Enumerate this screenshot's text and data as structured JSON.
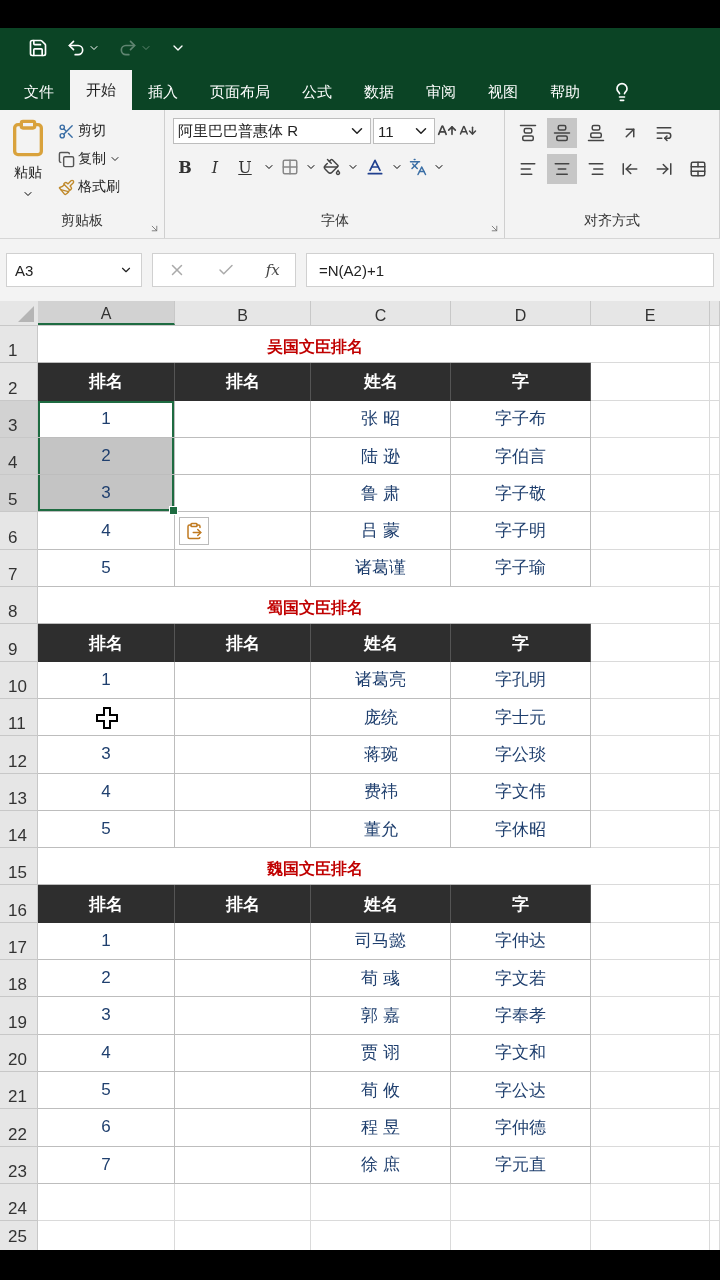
{
  "quick_access": {
    "redo_disabled": true
  },
  "tabs": [
    {
      "label": "文件",
      "selected": false
    },
    {
      "label": "开始",
      "selected": true
    },
    {
      "label": "插入",
      "selected": false
    },
    {
      "label": "页面布局",
      "selected": false
    },
    {
      "label": "公式",
      "selected": false
    },
    {
      "label": "数据",
      "selected": false
    },
    {
      "label": "审阅",
      "selected": false
    },
    {
      "label": "视图",
      "selected": false
    },
    {
      "label": "帮助",
      "selected": false
    }
  ],
  "ribbon": {
    "clipboard": {
      "paste": "粘贴",
      "cut": "剪切",
      "copy": "复制",
      "format_painter": "格式刷",
      "label": "剪贴板"
    },
    "font": {
      "font_name": "阿里巴巴普惠体 R",
      "font_size": "11",
      "bold": "B",
      "italic": "I",
      "underline": "U",
      "label": "字体"
    },
    "alignment": {
      "label": "对齐方式",
      "buttons": [
        {
          "kind": "top",
          "selected": false
        },
        {
          "kind": "middle",
          "selected": true
        },
        {
          "kind": "bottom",
          "selected": false
        },
        {
          "kind": "orientation",
          "selected": false
        },
        {
          "kind": "wrap",
          "selected": false
        },
        {
          "kind": "left",
          "selected": false
        },
        {
          "kind": "center",
          "selected": true
        },
        {
          "kind": "right",
          "selected": false
        },
        {
          "kind": "outdent",
          "selected": false
        },
        {
          "kind": "indent",
          "selected": false
        },
        {
          "kind": "merge",
          "selected": false
        }
      ]
    }
  },
  "formula_bar": {
    "name_box": "A3",
    "fx": "fx",
    "formula": "=N(A2)+1"
  },
  "columns": [
    {
      "label": "A",
      "selected": true
    },
    {
      "label": "B",
      "selected": false
    },
    {
      "label": "C",
      "selected": false
    },
    {
      "label": "D",
      "selected": false
    },
    {
      "label": "E",
      "selected": false
    }
  ],
  "rows": [
    {
      "number": "1",
      "kind": "title",
      "text": "吴国文臣排名"
    },
    {
      "number": "2",
      "kind": "header",
      "cells": [
        "排名",
        "排名",
        "姓名",
        "字"
      ]
    },
    {
      "number": "3",
      "kind": "data",
      "cells": [
        {
          "kind": "text",
          "text": "1",
          "selected": true
        },
        {
          "kind": "text",
          "selected": false
        },
        {
          "kind": "text",
          "text": "张 昭",
          "selected": false
        },
        {
          "kind": "text",
          "text": "字子布",
          "selected": false
        }
      ]
    },
    {
      "number": "4",
      "kind": "data",
      "cells": [
        {
          "kind": "text",
          "text": "2",
          "selected": true
        },
        {
          "kind": "text",
          "selected": false
        },
        {
          "kind": "text",
          "text": "陆 逊",
          "selected": false
        },
        {
          "kind": "text",
          "text": "字伯言",
          "selected": false
        }
      ]
    },
    {
      "number": "5",
      "kind": "data",
      "cells": [
        {
          "kind": "text",
          "text": "3",
          "selected": true
        },
        {
          "kind": "text",
          "selected": false
        },
        {
          "kind": "text",
          "text": "鲁 肃",
          "selected": false
        },
        {
          "kind": "text",
          "text": "字子敬",
          "selected": false
        }
      ]
    },
    {
      "number": "6",
      "kind": "data",
      "cells": [
        {
          "kind": "text",
          "text": "4",
          "selected": false
        },
        {
          "kind": "paste_options",
          "selected": false
        },
        {
          "kind": "text",
          "text": "吕 蒙",
          "selected": false
        },
        {
          "kind": "text",
          "text": "字子明",
          "selected": false
        }
      ]
    },
    {
      "number": "7",
      "kind": "data",
      "cells": [
        {
          "kind": "text",
          "text": "5",
          "selected": false
        },
        {
          "kind": "text",
          "selected": false
        },
        {
          "kind": "text",
          "text": "诸葛谨",
          "selected": false
        },
        {
          "kind": "text",
          "text": "字子瑜",
          "selected": false
        }
      ]
    },
    {
      "number": "8",
      "kind": "title",
      "text": "蜀国文臣排名"
    },
    {
      "number": "9",
      "kind": "header",
      "cells": [
        "排名",
        "排名",
        "姓名",
        "字"
      ]
    },
    {
      "number": "10",
      "kind": "data",
      "cells": [
        {
          "kind": "text",
          "text": "1",
          "selected": false
        },
        {
          "kind": "text",
          "selected": false
        },
        {
          "kind": "text",
          "text": "诸葛亮",
          "selected": false
        },
        {
          "kind": "text",
          "text": "字孔明",
          "selected": false
        }
      ]
    },
    {
      "number": "11",
      "kind": "data",
      "cells": [
        {
          "kind": "cursor",
          "selected": false
        },
        {
          "kind": "text",
          "selected": false
        },
        {
          "kind": "text",
          "text": "庞统",
          "selected": false
        },
        {
          "kind": "text",
          "text": "字士元",
          "selected": false
        }
      ]
    },
    {
      "number": "12",
      "kind": "data",
      "cells": [
        {
          "kind": "text",
          "text": "3",
          "selected": false
        },
        {
          "kind": "text",
          "selected": false
        },
        {
          "kind": "text",
          "text": "蒋琬",
          "selected": false
        },
        {
          "kind": "text",
          "text": "字公琰",
          "selected": false
        }
      ]
    },
    {
      "number": "13",
      "kind": "data",
      "cells": [
        {
          "kind": "text",
          "text": "4",
          "selected": false
        },
        {
          "kind": "text",
          "selected": false
        },
        {
          "kind": "text",
          "text": "费祎",
          "selected": false
        },
        {
          "kind": "text",
          "text": "字文伟",
          "selected": false
        }
      ]
    },
    {
      "number": "14",
      "kind": "data",
      "cells": [
        {
          "kind": "text",
          "text": "5",
          "selected": false
        },
        {
          "kind": "text",
          "selected": false
        },
        {
          "kind": "text",
          "text": "董允",
          "selected": false
        },
        {
          "kind": "text",
          "text": "字休昭",
          "selected": false
        }
      ]
    },
    {
      "number": "15",
      "kind": "title",
      "text": "魏国文臣排名"
    },
    {
      "number": "16",
      "kind": "header",
      "cells": [
        "排名",
        "排名",
        "姓名",
        "字"
      ]
    },
    {
      "number": "17",
      "kind": "data",
      "cells": [
        {
          "kind": "text",
          "text": "1",
          "selected": false
        },
        {
          "kind": "text",
          "selected": false
        },
        {
          "kind": "text",
          "text": "司马懿",
          "selected": false
        },
        {
          "kind": "text",
          "text": "字仲达",
          "selected": false
        }
      ]
    },
    {
      "number": "18",
      "kind": "data",
      "cells": [
        {
          "kind": "text",
          "text": "2",
          "selected": false
        },
        {
          "kind": "text",
          "selected": false
        },
        {
          "kind": "text",
          "text": "荀 彧",
          "selected": false
        },
        {
          "kind": "text",
          "text": "字文若",
          "selected": false
        }
      ]
    },
    {
      "number": "19",
      "kind": "data",
      "cells": [
        {
          "kind": "text",
          "text": "3",
          "selected": false
        },
        {
          "kind": "text",
          "selected": false
        },
        {
          "kind": "text",
          "text": "郭 嘉",
          "selected": false
        },
        {
          "kind": "text",
          "text": "字奉孝",
          "selected": false
        }
      ]
    },
    {
      "number": "20",
      "kind": "data",
      "cells": [
        {
          "kind": "text",
          "text": "4",
          "selected": false
        },
        {
          "kind": "text",
          "selected": false
        },
        {
          "kind": "text",
          "text": "贾 诩",
          "selected": false
        },
        {
          "kind": "text",
          "text": "字文和",
          "selected": false
        }
      ]
    },
    {
      "number": "21",
      "kind": "data",
      "cells": [
        {
          "kind": "text",
          "text": "5",
          "selected": false
        },
        {
          "kind": "text",
          "selected": false
        },
        {
          "kind": "text",
          "text": "荀 攸",
          "selected": false
        },
        {
          "kind": "text",
          "text": "字公达",
          "selected": false
        }
      ]
    },
    {
      "number": "22",
      "kind": "data",
      "cells": [
        {
          "kind": "text",
          "text": "6",
          "selected": false
        },
        {
          "kind": "text",
          "selected": false
        },
        {
          "kind": "text",
          "text": "程 昱",
          "selected": false
        },
        {
          "kind": "text",
          "text": "字仲德",
          "selected": false
        }
      ]
    },
    {
      "number": "23",
      "kind": "data",
      "cells": [
        {
          "kind": "text",
          "text": "7",
          "selected": false
        },
        {
          "kind": "text",
          "selected": false
        },
        {
          "kind": "text",
          "text": "徐 庶",
          "selected": false
        },
        {
          "kind": "text",
          "text": "字元直",
          "selected": false
        }
      ]
    },
    {
      "number": "24",
      "kind": "empty"
    },
    {
      "number": "25",
      "kind": "empty"
    }
  ]
}
